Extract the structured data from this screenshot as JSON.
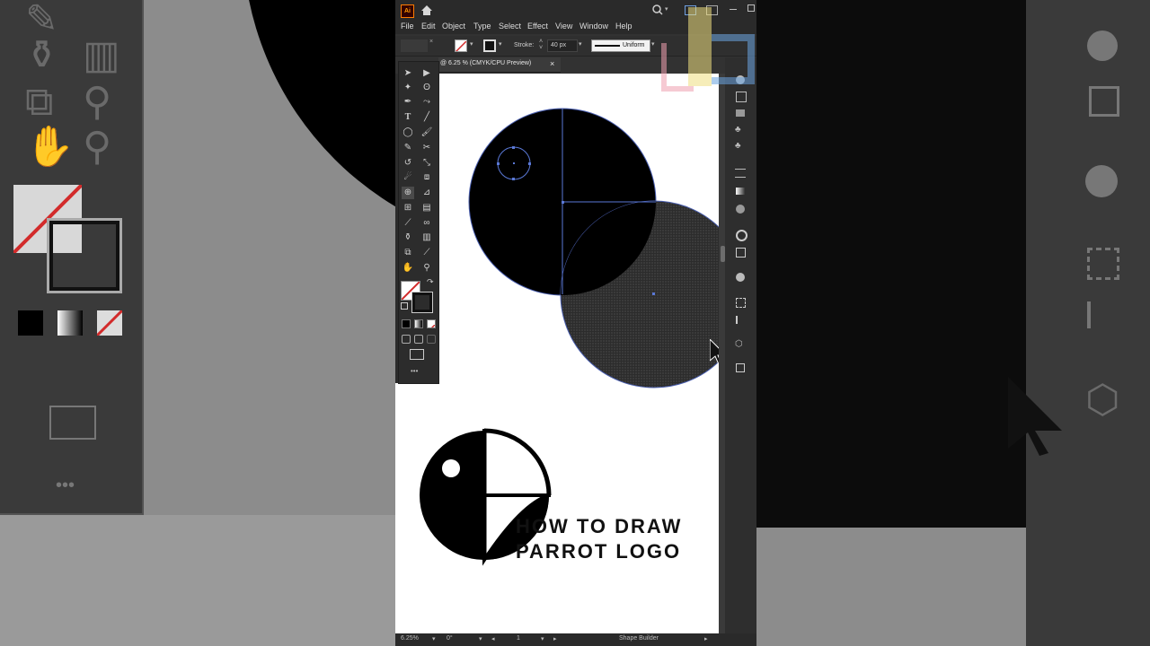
{
  "menu": [
    "File",
    "Edit",
    "Object",
    "Type",
    "Select",
    "Effect",
    "View",
    "Window",
    "Help"
  ],
  "app_badge": "Ai",
  "control": {
    "stroke_label": "Stroke:",
    "stroke_width": "40 px",
    "profile": "Uniform"
  },
  "document_tab": {
    "title": "@ 6.25 % (CMYK/CPU Preview)",
    "close": "×"
  },
  "artwork_text": {
    "line1": "HOW TO DRAW",
    "line2": "PARROT LOGO"
  },
  "status": {
    "zoom": "6.25%",
    "rotation": "0°",
    "artboard": "1",
    "tool": "Shape Builder"
  },
  "toolbar_more": "•••",
  "icons": [
    "selection-tool",
    "direct-selection-tool",
    "magic-wand",
    "lasso",
    "pen",
    "curvature",
    "type",
    "line",
    "ellipse",
    "paintbrush",
    "shaper",
    "scissors",
    "rotate",
    "scale",
    "warp",
    "free-transform",
    "shape-builder",
    "perspective",
    "mesh",
    "gradient",
    "eyedropper",
    "blend",
    "symbol-sprayer",
    "graph",
    "artboard",
    "slice",
    "hand",
    "zoom"
  ],
  "colors": {
    "accent": "#5a78d6",
    "app_bg": "#323232",
    "canvas": "#ffffff",
    "none_swatch": "#d22b2b"
  }
}
